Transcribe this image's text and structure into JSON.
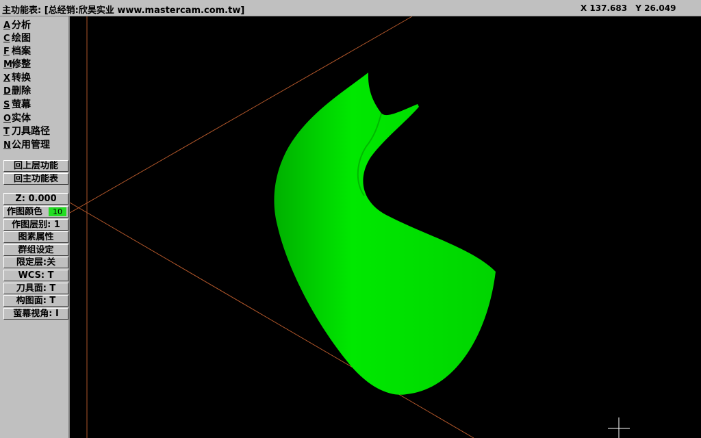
{
  "titlebar": {
    "title": "主功能表: [总经销:欣昊实业 www.mastercam.com.tw]",
    "coord_x": "X 137.683",
    "coord_y": "Y 26.049"
  },
  "main_menu": [
    {
      "key": "A",
      "label": "分析",
      "name": "menu-item-analyze"
    },
    {
      "key": "C",
      "label": "绘图",
      "name": "menu-item-create"
    },
    {
      "key": "F",
      "label": "档案",
      "name": "menu-item-file"
    },
    {
      "key": "M",
      "label": "修整",
      "name": "menu-item-modify"
    },
    {
      "key": "X",
      "label": "转换",
      "name": "menu-item-xform"
    },
    {
      "key": "D",
      "label": "删除",
      "name": "menu-item-delete"
    },
    {
      "key": "S",
      "label": "萤幕",
      "name": "menu-item-screen"
    },
    {
      "key": "O",
      "label": "实体",
      "name": "menu-item-solids"
    },
    {
      "key": "T",
      "label": "刀具路径",
      "name": "menu-item-toolpaths"
    },
    {
      "key": "N",
      "label": "公用管理",
      "name": "menu-item-nc-utils"
    }
  ],
  "nav_buttons": {
    "back_up": "回上层功能",
    "main_menu": "回主功能表"
  },
  "settings": {
    "z_depth": "Z:  0.000",
    "color_label": "作图颜色",
    "color_value": "10",
    "level": "作图层别:  1",
    "attributes": "图素属性",
    "groups": "群组设定",
    "mask": "限定层:关",
    "wcs": "WCS:  T",
    "tool_plane": "刀具面: T",
    "cplane": "构图面: T",
    "gview": "萤幕视角: I"
  },
  "colors": {
    "panel": "#c0c0c0",
    "viewport_bg": "#000000",
    "axis_line": "#b0562a",
    "surface": "#00e600",
    "color_swatch": "#22dd22"
  }
}
